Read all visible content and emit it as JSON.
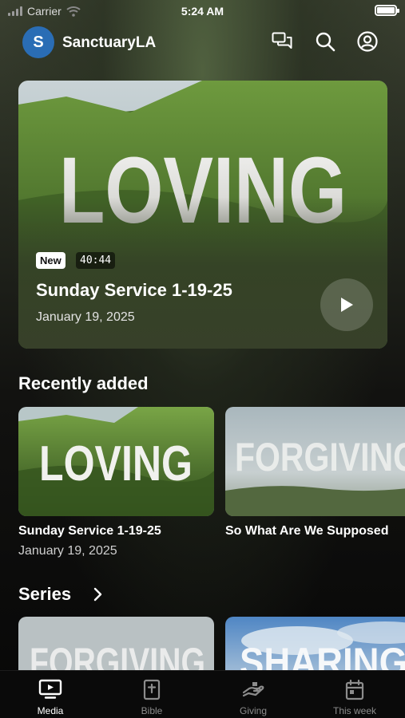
{
  "status_bar": {
    "carrier": "Carrier",
    "time": "5:24 AM"
  },
  "header": {
    "app_name": "SanctuaryLA",
    "logo_letter": "S"
  },
  "featured": {
    "art_text": "LOVING",
    "badge": "New",
    "duration": "40:44",
    "title": "Sunday Service 1-19-25",
    "date": "January 19, 2025"
  },
  "recently_added": {
    "heading": "Recently added",
    "items": [
      {
        "art_text": "LOVING",
        "title": "Sunday Service 1-19-25",
        "date": "January 19, 2025"
      },
      {
        "art_text": "FORGIVING",
        "title": "So What Are We Supposed"
      }
    ]
  },
  "series": {
    "heading": "Series",
    "items": [
      {
        "art_text": "FORGIVING"
      },
      {
        "art_text": "SHARING"
      }
    ]
  },
  "tabs": [
    {
      "label": "Media",
      "icon": "tv-icon",
      "active": true
    },
    {
      "label": "Bible",
      "icon": "bible-icon",
      "active": false
    },
    {
      "label": "Giving",
      "icon": "giving-hand-icon",
      "active": false
    },
    {
      "label": "This week",
      "icon": "calendar-icon",
      "active": false
    }
  ],
  "colors": {
    "accent_logo": "#2a6db5",
    "background": "#0b0b0a"
  }
}
